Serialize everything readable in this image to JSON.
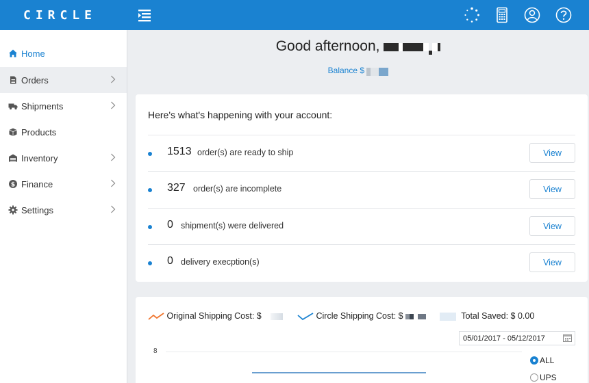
{
  "app": {
    "logo": "CIRCLE"
  },
  "header": {
    "icons": [
      "loading-spinner-icon",
      "calculator-icon",
      "user-icon",
      "help-icon"
    ]
  },
  "sidebar": {
    "items": [
      {
        "label": "Home",
        "icon": "home-icon",
        "chevron": false
      },
      {
        "label": "Orders",
        "icon": "document-icon",
        "chevron": true
      },
      {
        "label": "Shipments",
        "icon": "truck-icon",
        "chevron": true
      },
      {
        "label": "Products",
        "icon": "box-icon",
        "chevron": false
      },
      {
        "label": "Inventory",
        "icon": "warehouse-icon",
        "chevron": true
      },
      {
        "label": "Finance",
        "icon": "dollar-icon",
        "chevron": true
      },
      {
        "label": "Settings",
        "icon": "gear-icon",
        "chevron": true
      }
    ]
  },
  "greeting": {
    "text": "Good afternoon,"
  },
  "balance": {
    "label": "Balance $"
  },
  "account": {
    "title": "Here's what's happening with your account:",
    "rows": [
      {
        "count": "1513",
        "text": "order(s) are ready to ship",
        "button": "View"
      },
      {
        "count": "327",
        "text": "order(s) are incomplete",
        "button": "View"
      },
      {
        "count": "0",
        "text": "shipment(s) were delivered",
        "button": "View"
      },
      {
        "count": "0",
        "text": "delivery execption(s)",
        "button": "View"
      }
    ]
  },
  "costs": {
    "original_label": "Original Shipping Cost: $",
    "circle_label": "Circle Shipping Cost: $",
    "saved_label": "Total Saved: $ 0.00",
    "date_range": "05/01/2017 - 05/12/2017",
    "y_tick": "8",
    "carriers": [
      {
        "label": "ALL",
        "selected": true
      },
      {
        "label": "UPS",
        "selected": false
      }
    ],
    "colors": {
      "original": "#f0732a",
      "circle": "#1a82d1"
    }
  },
  "colors": {
    "brand": "#1a82d1",
    "background": "#eceef1"
  }
}
